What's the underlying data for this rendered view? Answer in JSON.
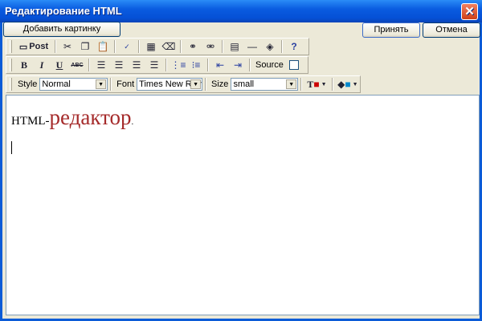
{
  "window": {
    "title": "Редактирование HTML"
  },
  "buttons": {
    "add_image": "Добавить картинку",
    "accept": "Принять",
    "cancel": "Отмена"
  },
  "toolbar": {
    "post": "Post",
    "source": "Source",
    "style_label": "Style",
    "style_value": "Normal",
    "font_label": "Font",
    "font_value": "Times New Roman",
    "size_label": "Size",
    "size_value": "small"
  },
  "content": {
    "prefix": "HTML-",
    "word": "редактор",
    "suffix": ".",
    "accent": "#a52a2a"
  }
}
